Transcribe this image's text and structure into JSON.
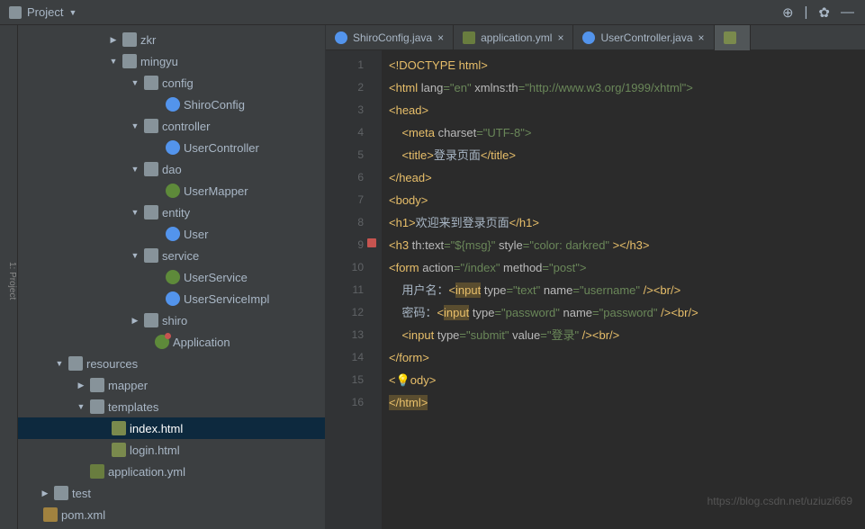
{
  "toolbar": {
    "project_label": "Project"
  },
  "tree": {
    "zkr": "zkr",
    "mingyu": "mingyu",
    "config": "config",
    "shiroconfig": "ShiroConfig",
    "controller": "controller",
    "usercontroller": "UserController",
    "dao": "dao",
    "usermapper": "UserMapper",
    "entity": "entity",
    "user": "User",
    "service": "service",
    "userservice": "UserService",
    "userserviceimpl": "UserServiceImpl",
    "shiro": "shiro",
    "application": "Application",
    "resources": "resources",
    "mapper": "mapper",
    "templates": "templates",
    "indexhtml": "index.html",
    "loginhtml": "login.html",
    "applicationyml": "application.yml",
    "test": "test",
    "pomxml": "pom.xml"
  },
  "tabs": {
    "t1": "ShiroConfig.java",
    "t2": "application.yml",
    "t3": "UserController.java"
  },
  "code": {
    "l1": "<!DOCTYPE html>",
    "l2a": "<html ",
    "l2b": "lang",
    "l2c": "=\"en\" ",
    "l2d": "xmlns:th",
    "l2e": "=\"http://www.w3.org/1999/xhtml\">",
    "l3": "<head>",
    "l4a": "    <meta ",
    "l4b": "charset",
    "l4c": "=\"UTF-8\">",
    "l5a": "    <title>",
    "l5b": "登录页面",
    "l5c": "</title>",
    "l6": "</head>",
    "l7": "<body>",
    "l8a": "<h1>",
    "l8b": "欢迎来到登录页面",
    "l8c": "</h1>",
    "l9a": "<h3 ",
    "l9b": "th:text",
    "l9c": "=\"${msg}\" ",
    "l9d": "style",
    "l9e": "=\"color: darkred\" ",
    "l9f": "></h3>",
    "l10a": "<form ",
    "l10b": "action",
    "l10c": "=\"/index\" ",
    "l10d": "method",
    "l10e": "=\"post\">",
    "l11a": "    用户名：",
    "l11b": "<",
    "l11c": "input",
    "l11d": " type",
    "l11e": "=\"text\" ",
    "l11f": "name",
    "l11g": "=\"username\" ",
    "l11h": "/><br/>",
    "l12a": "    密码：",
    "l12b": "<",
    "l12c": "input",
    "l12d": " type",
    "l12e": "=\"password\" ",
    "l12f": "name",
    "l12g": "=\"password\" ",
    "l12h": "/><br/>",
    "l13a": "    <input ",
    "l13b": "type",
    "l13c": "=\"submit\" ",
    "l13d": "value",
    "l13e": "=\"登录\" ",
    "l13f": "/><br/>",
    "l14": "</form>",
    "l15a": "<",
    "l15b": "ody>",
    "l16": "</html>"
  },
  "watermark": "https://blog.csdn.net/uziuzi669"
}
